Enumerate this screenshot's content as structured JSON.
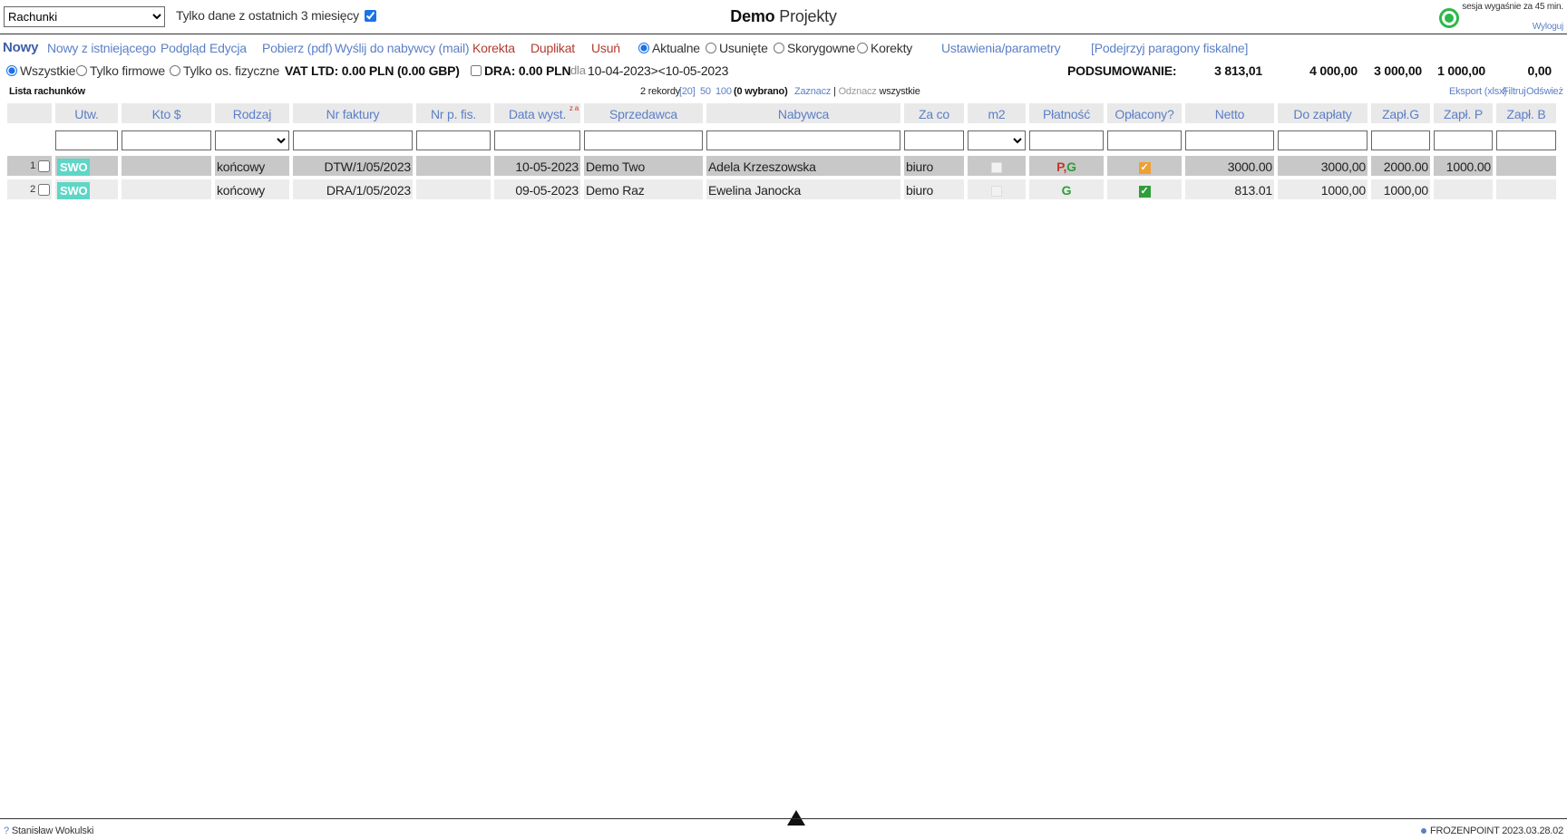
{
  "header": {
    "module_select": "Rachunki",
    "recent_label": "Tylko dane z ostatnich 3 miesięcy",
    "title_bold": "Demo",
    "title_rest": "Projekty",
    "session_text": "sesja wygaśnie za 45 min.",
    "logout_label": "Wyloguj",
    "status_color": "#2db84a"
  },
  "actions": {
    "new": "Nowy",
    "new_from": "Nowy z istniejącego",
    "preview": "Podgląd",
    "edit": "Edycja",
    "download": "Pobierz (pdf)",
    "send": "Wyślij do nabywcy (mail)",
    "correction": "Korekta",
    "duplicate": "Duplikat",
    "delete": "Usuń",
    "radio_current": "Aktualne",
    "radio_deleted": "Usunięte",
    "radio_corrected": "Skorygowne",
    "radio_corrections": "Korekty",
    "settings": "Ustawienia/parametry",
    "receipts": "[Podejrzyj paragony fiskalne]"
  },
  "filters": {
    "all": "Wszystkie",
    "company": "Tylko firmowe",
    "persons": "Tylko os. fizyczne",
    "vat": "VAT LTD: 0.00 PLN (0.00 GBP)",
    "dra": "DRA: 0.00 PLN",
    "for": "dla",
    "range": "10-04-2023><10-05-2023"
  },
  "summary": {
    "label": "PODSUMOWANIE:",
    "netto": "3 813,01",
    "topay": "4 000,00",
    "paid_g": "3 000,00",
    "paid_p": "1 000,00",
    "paid_b": "0,00"
  },
  "list": {
    "title": "Lista rachunków",
    "records": "2 rekordy",
    "page20": "[20]",
    "page50": "50",
    "page100": "100",
    "selected": "(0 wybrano)",
    "select": "Zaznacz",
    "deselect": "Odznacz",
    "all": "wszystkie",
    "export": "Eksport (xlsx)",
    "filter": "Filtruj",
    "refresh": "Odśwież"
  },
  "columns": [
    "Utw.",
    "Kto $",
    "Rodzaj",
    "Nr faktury",
    "Nr p. fis.",
    "Data wyst.",
    "Sprzedawca",
    "Nabywca",
    "Za co",
    "m2",
    "Płatność",
    "Opłacony?",
    "Netto",
    "Do zapłaty",
    "Zapł.G",
    "Zapł. P",
    "Zapł. B"
  ],
  "sort_mark": "z a",
  "rows": [
    {
      "num": "1",
      "creator": "SWO",
      "kind": "końcowy",
      "invoice": "DTW/1/05/2023",
      "date": "10-05-2023",
      "seller": "Demo Two",
      "buyer": "Adela Krzeszowska",
      "for": "biuro",
      "pay_p": "P",
      "pay_sep": ",",
      "pay_g": "G",
      "paid_color": "#f0a030",
      "netto": "3000.00",
      "topay": "3000,00",
      "paid_g": "2000.00",
      "paid_p": "1000.00",
      "paid_b": ""
    },
    {
      "num": "2",
      "creator": "SWO",
      "kind": "końcowy",
      "invoice": "DRA/1/05/2023",
      "date": "09-05-2023",
      "seller": "Demo Raz",
      "buyer": "Ewelina Janocka",
      "for": "biuro",
      "pay_p": "",
      "pay_sep": "",
      "pay_g": "G",
      "paid_color": "#2e9e3a",
      "netto": "813.01",
      "topay": "1000,00",
      "paid_g": "1000,00",
      "paid_p": "",
      "paid_b": ""
    }
  ],
  "footer": {
    "user": "Stanisław Wokulski",
    "help": "?",
    "version": "FROZENPOINT 2023.03.28.02"
  }
}
